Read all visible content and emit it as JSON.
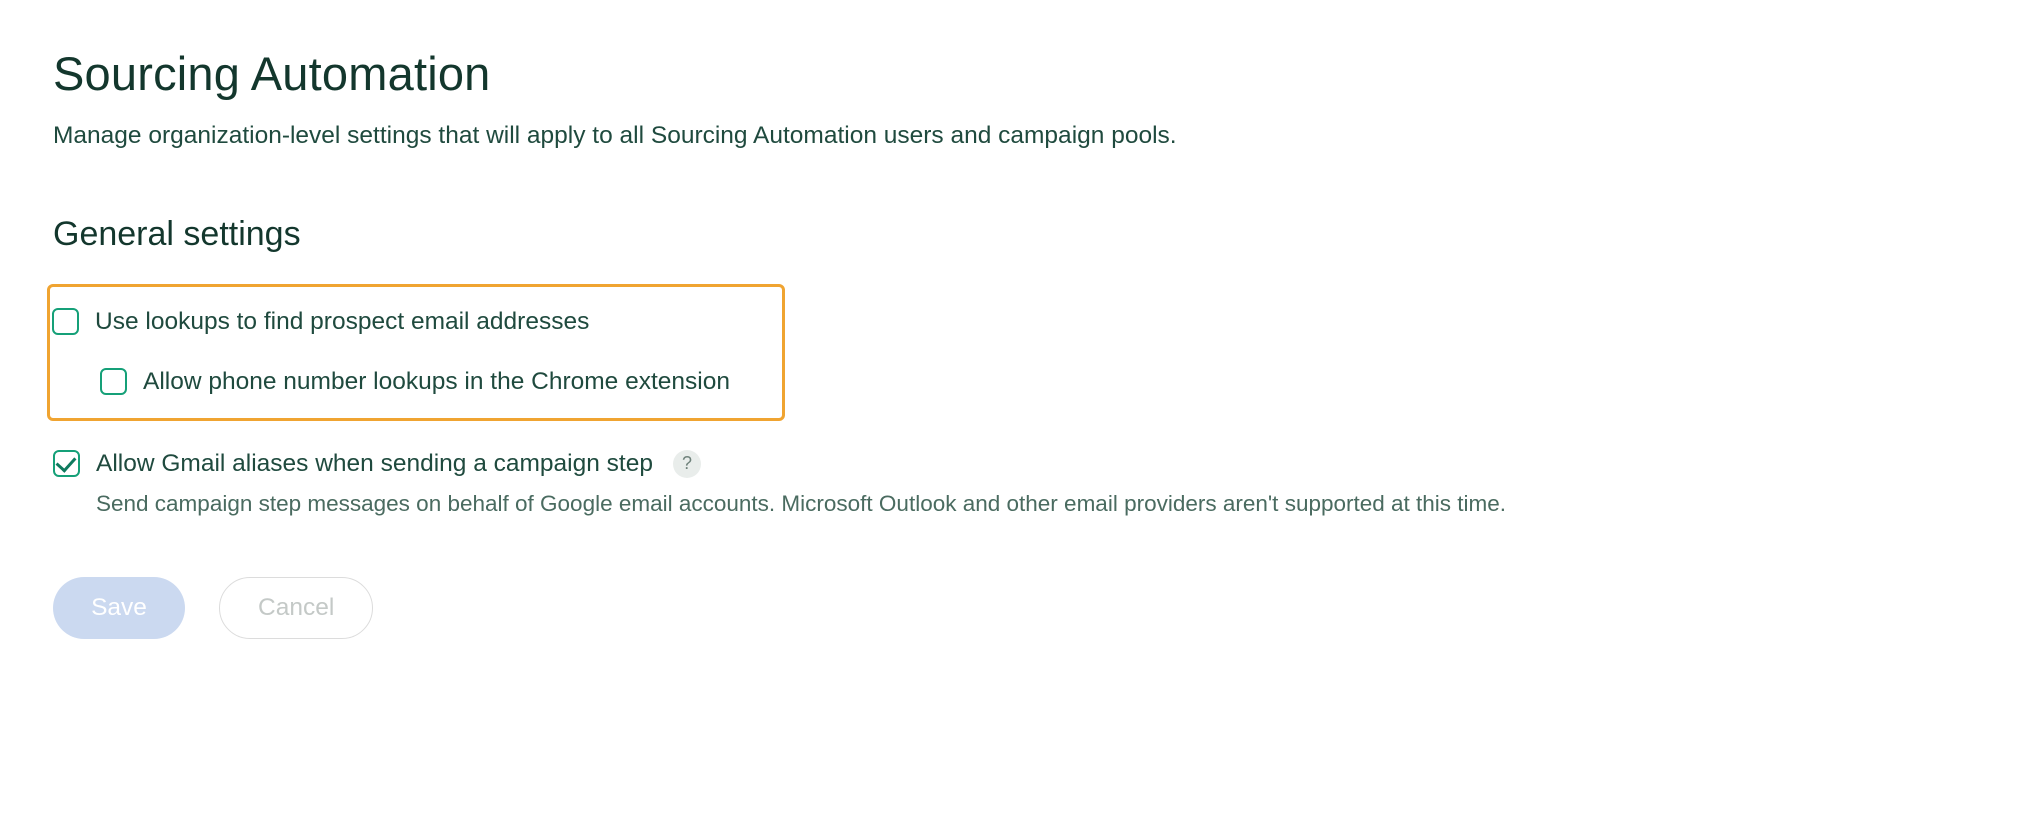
{
  "page": {
    "title": "Sourcing Automation",
    "subtitle": "Manage organization-level settings that will apply to all Sourcing Automation users and campaign pools."
  },
  "general": {
    "heading": "General settings",
    "lookup_email": {
      "label": "Use lookups to find prospect email addresses",
      "checked": false
    },
    "lookup_phone": {
      "label": "Allow phone number lookups in the Chrome extension",
      "checked": false
    },
    "gmail_alias": {
      "label": "Allow Gmail aliases when sending a campaign step",
      "checked": true,
      "help": "?",
      "description": "Send campaign step messages on behalf of Google email accounts. Microsoft Outlook and other email providers aren't supported at this time."
    }
  },
  "actions": {
    "save": "Save",
    "cancel": "Cancel"
  }
}
